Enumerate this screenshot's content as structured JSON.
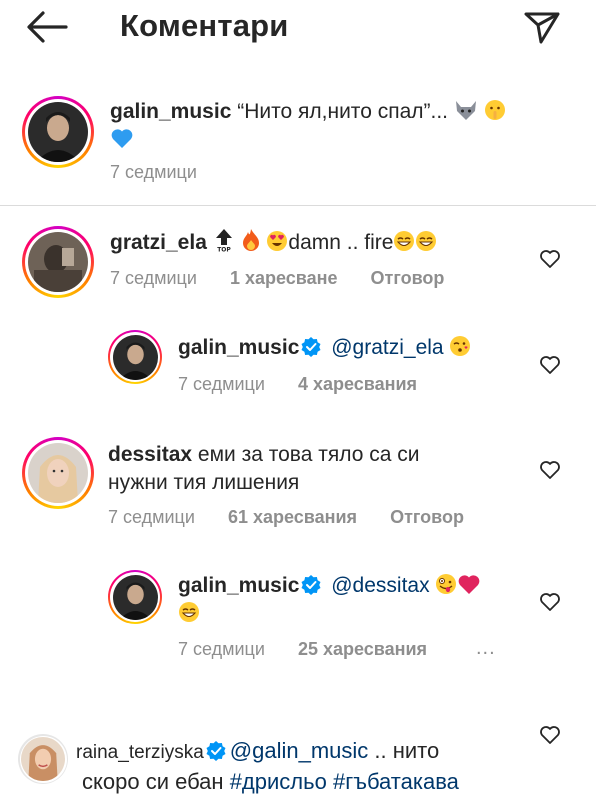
{
  "header": {
    "title": "Коментари",
    "back_icon": "arrow-left-icon",
    "share_icon": "paper-plane-icon"
  },
  "caption": {
    "username": "galin_music",
    "text": "“Нито ял,нито спал”...",
    "time": "7 седмици"
  },
  "comments": [
    {
      "username": "gratzi_ela",
      "text_after": "damn .. fire",
      "time": "7 седмици",
      "likes": "1 харесване",
      "reply": "Отговор"
    },
    {
      "username": "galin_music",
      "mention": "@gratzi_ela",
      "time": "7 седмици",
      "likes": "4 харесвания"
    },
    {
      "username": "dessitax",
      "text_line1": "еми за това тяло са си",
      "text_line2": "нужни тия лишения",
      "time": "7 седмици",
      "likes": "61 харесвания",
      "reply": "Отговор"
    },
    {
      "username": "galin_music",
      "mention": "@dessitax",
      "time": "7 седмици",
      "likes": "25 харесвания",
      "more": "..."
    },
    {
      "username": "raina_terziyska",
      "mention": "@galin_music",
      "text_after": ".. нито",
      "text_line2": "скоро си ебан",
      "hashtags": [
        "#дрисльо",
        "#гъбатакава"
      ]
    }
  ],
  "colors": {
    "text": "#262626",
    "secondary": "#8e8e8e",
    "link": "#00376b",
    "verified": "#0095f6"
  }
}
